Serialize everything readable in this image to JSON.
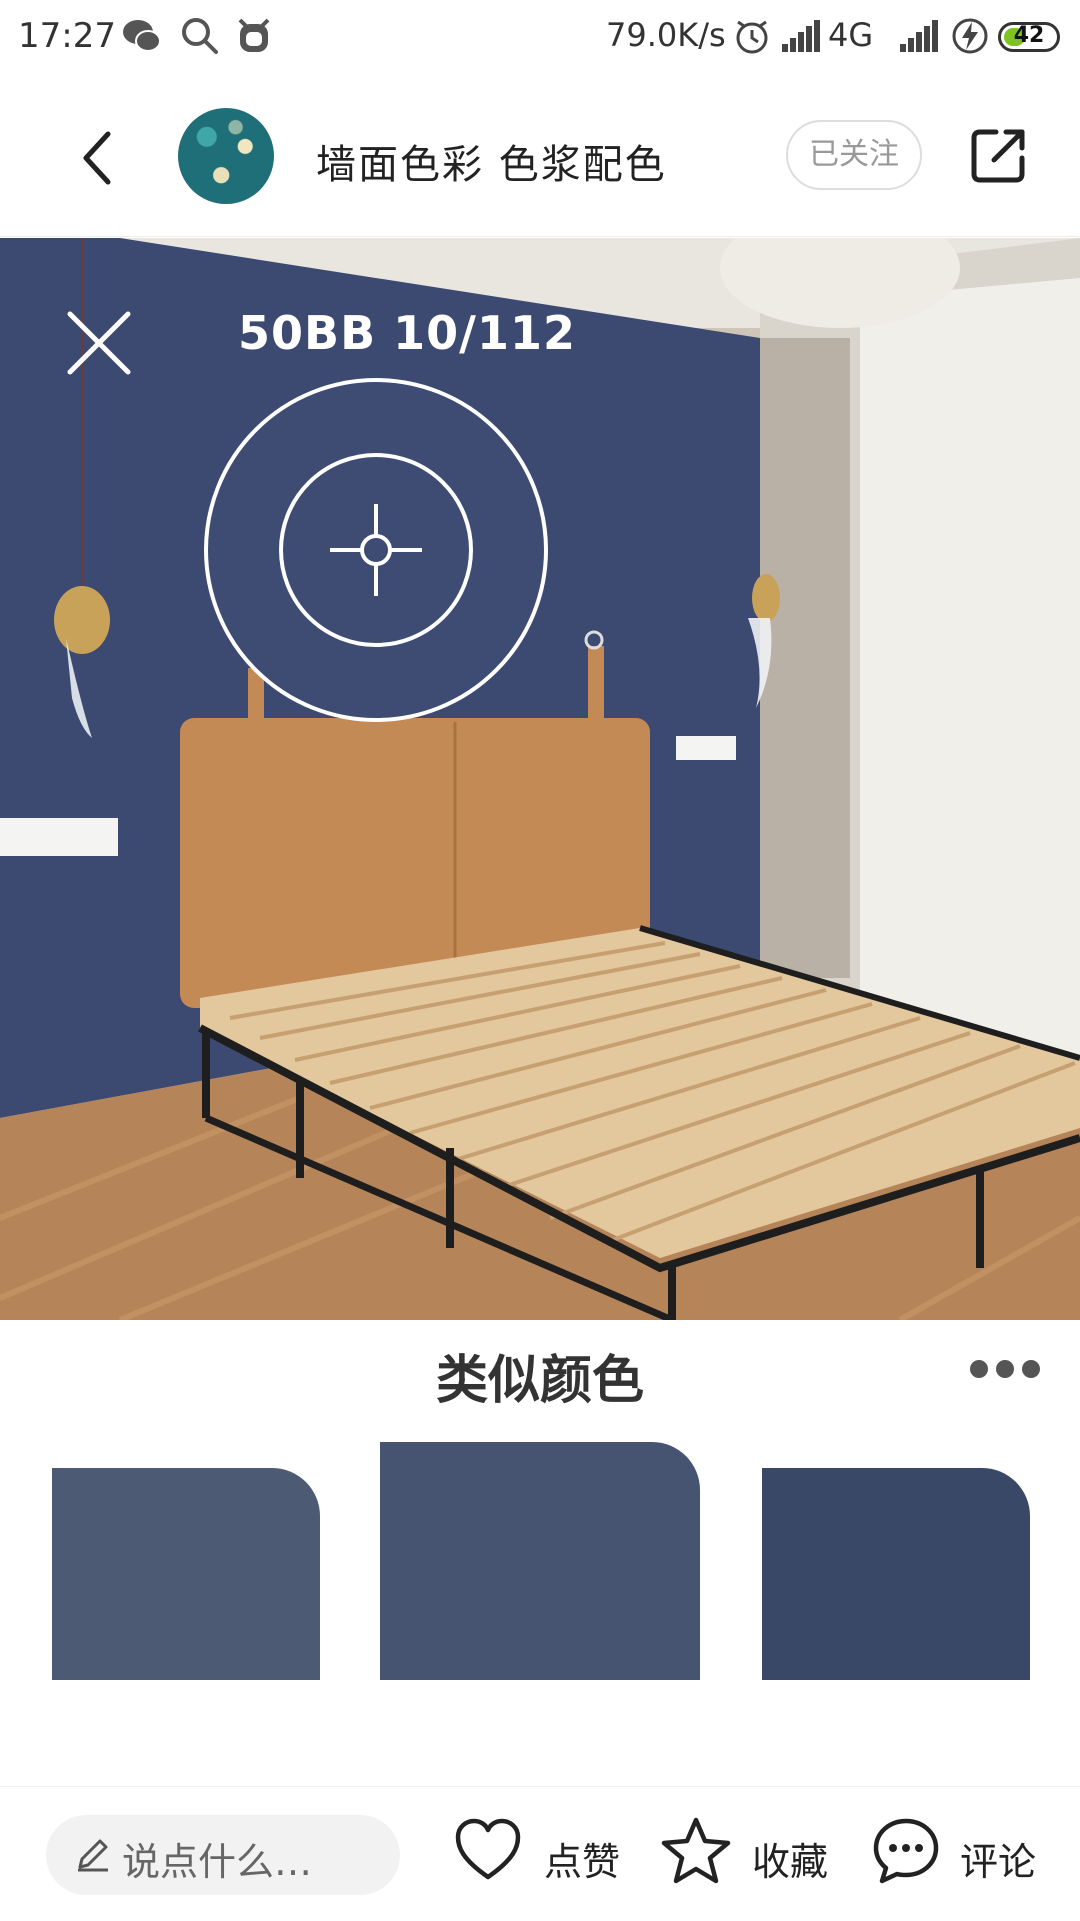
{
  "status_bar": {
    "time": "17:27",
    "net_speed": "79.0K/s",
    "network": "4G",
    "battery_level": "42",
    "battery_fraction": 0.42,
    "icons": [
      "wechat-icon",
      "search-icon",
      "alarm-clock-app-icon",
      "alarm-icon",
      "signal-icon",
      "charging-icon"
    ]
  },
  "header": {
    "title": "墙面色彩 色浆配色",
    "follow_label": "已关注"
  },
  "photo": {
    "color_code": "50BB 10/112",
    "description_icon": "crosshair-picker-icon"
  },
  "similar": {
    "title": "类似颜色",
    "swatches": [
      {
        "color": "#4c5a74"
      },
      {
        "color": "#465471"
      },
      {
        "color": "#384866"
      }
    ]
  },
  "bottom_bar": {
    "comment_placeholder": "说点什么…",
    "like_label": "点赞",
    "favorite_label": "收藏",
    "comment_label": "评论"
  },
  "colors": {
    "wall": "#3c4a72",
    "headboard": "#c48a55",
    "battery_fill": "#7ec321"
  }
}
